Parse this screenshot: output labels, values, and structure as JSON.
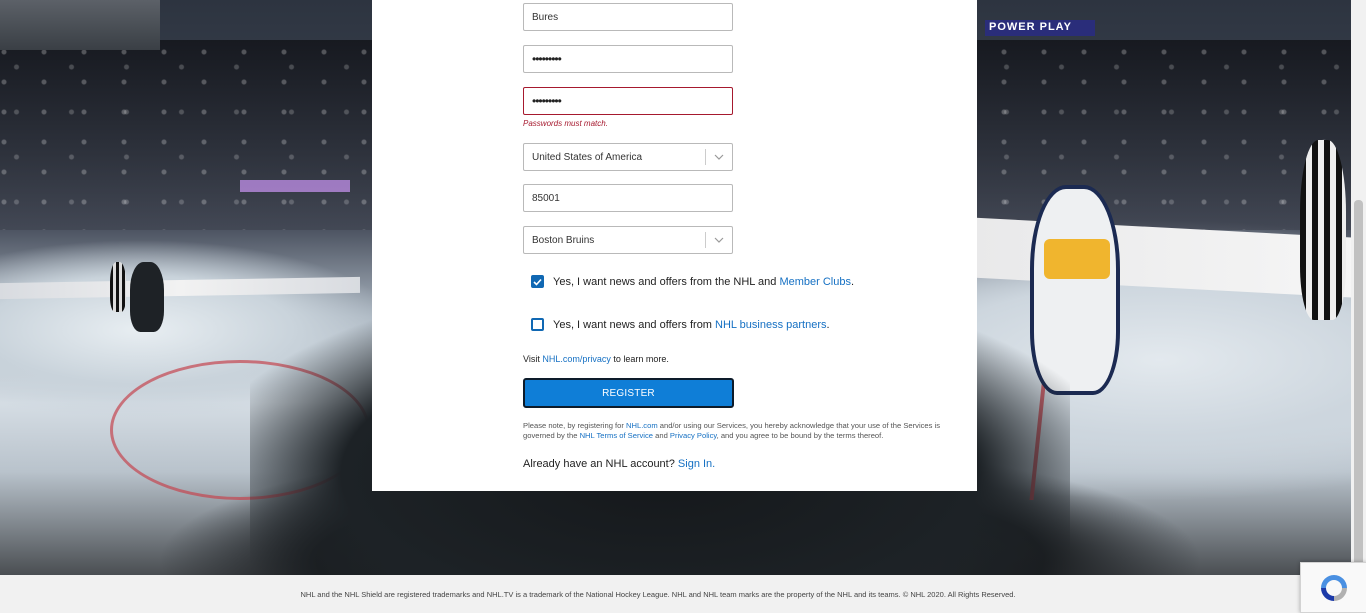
{
  "form": {
    "last_name_value": "Bures",
    "password_value": "•••••••••",
    "confirm_password_value": "•••••••••",
    "password_error": "Passwords must match.",
    "country_value": "United States of America",
    "zip_value": "85001",
    "team_value": "Boston Bruins",
    "nhl_offers": {
      "checked": true,
      "text": "Yes, I want news and offers from the NHL and ",
      "link": "Member Clubs",
      "suffix": "."
    },
    "partner_offers": {
      "checked": false,
      "text": "Yes, I want news and offers from ",
      "link": "NHL business partners",
      "suffix": "."
    },
    "visit_prefix": "Visit ",
    "visit_link": "NHL.com/privacy",
    "visit_suffix": " to learn more.",
    "register_label": "REGISTER",
    "legal": {
      "part1": "Please note, by registering for ",
      "link1": "NHL.com",
      "part2": " and/or using our Services, you hereby acknowledge that your use of the Services is governed by the ",
      "link2": "NHL Terms of Service",
      "part3": " and ",
      "link3": "Privacy Policy",
      "part4": ", and you agree to be bound by the terms thereof."
    },
    "signin_prefix": "Already have an NHL account? ",
    "signin_link": "Sign In."
  },
  "footer": {
    "text": "NHL and the NHL Shield are registered trademarks and NHL.TV is a trademark of the National Hockey League. NHL and NHL team marks are the property of the NHL and its teams. © NHL 2020. All Rights Reserved."
  },
  "colors": {
    "accent": "#0f7ed7",
    "link": "#1570c3",
    "error": "#a6192e"
  },
  "icons": {
    "select_arrow": "chevron-down-icon",
    "check": "checkmark-icon",
    "recaptcha": "recaptcha-icon"
  }
}
